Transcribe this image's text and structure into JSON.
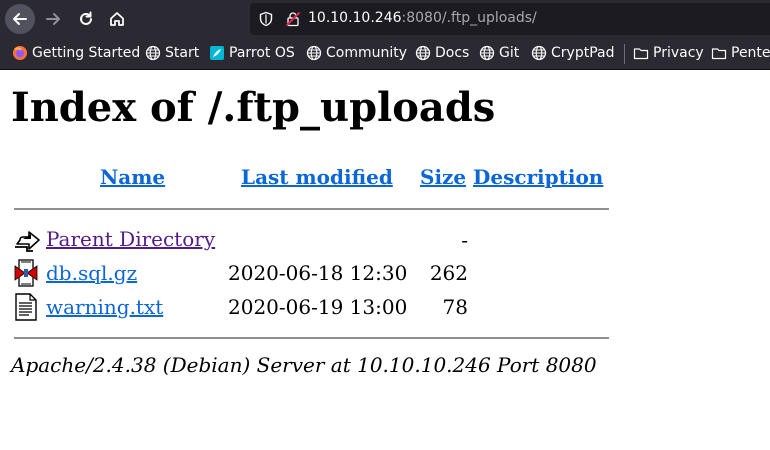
{
  "browser": {
    "url_host": "10.10.10.246",
    "url_rest": ":8080/.ftp_uploads/"
  },
  "bookmarks": [
    {
      "label": "Getting Started",
      "icon": "firefox-icon"
    },
    {
      "label": "Start",
      "icon": "globe-icon"
    },
    {
      "label": "Parrot OS",
      "icon": "parrot-icon"
    },
    {
      "label": "Community",
      "icon": "globe-icon"
    },
    {
      "label": "Docs",
      "icon": "globe-icon"
    },
    {
      "label": "Git",
      "icon": "globe-icon"
    },
    {
      "label": "CryptPad",
      "icon": "globe-icon"
    },
    {
      "label": "Privacy",
      "icon": "folder-icon"
    },
    {
      "label": "Pente",
      "icon": "folder-icon"
    }
  ],
  "page": {
    "title": "Index of /.ftp_uploads",
    "columns": {
      "name": "Name",
      "last_modified": "Last modified",
      "size": "Size",
      "description": "Description"
    },
    "rows": [
      {
        "name": "Parent Directory",
        "modified": "",
        "size": "-",
        "icon": "back-arrow-icon"
      },
      {
        "name": "db.sql.gz",
        "modified": "2020-06-18 12:30",
        "size": "262",
        "icon": "compressed-file-icon"
      },
      {
        "name": "warning.txt",
        "modified": "2020-06-19 13:00",
        "size": "78",
        "icon": "text-file-icon"
      }
    ],
    "footer": "Apache/2.4.38 (Debian) Server at 10.10.10.246 Port 8080"
  }
}
